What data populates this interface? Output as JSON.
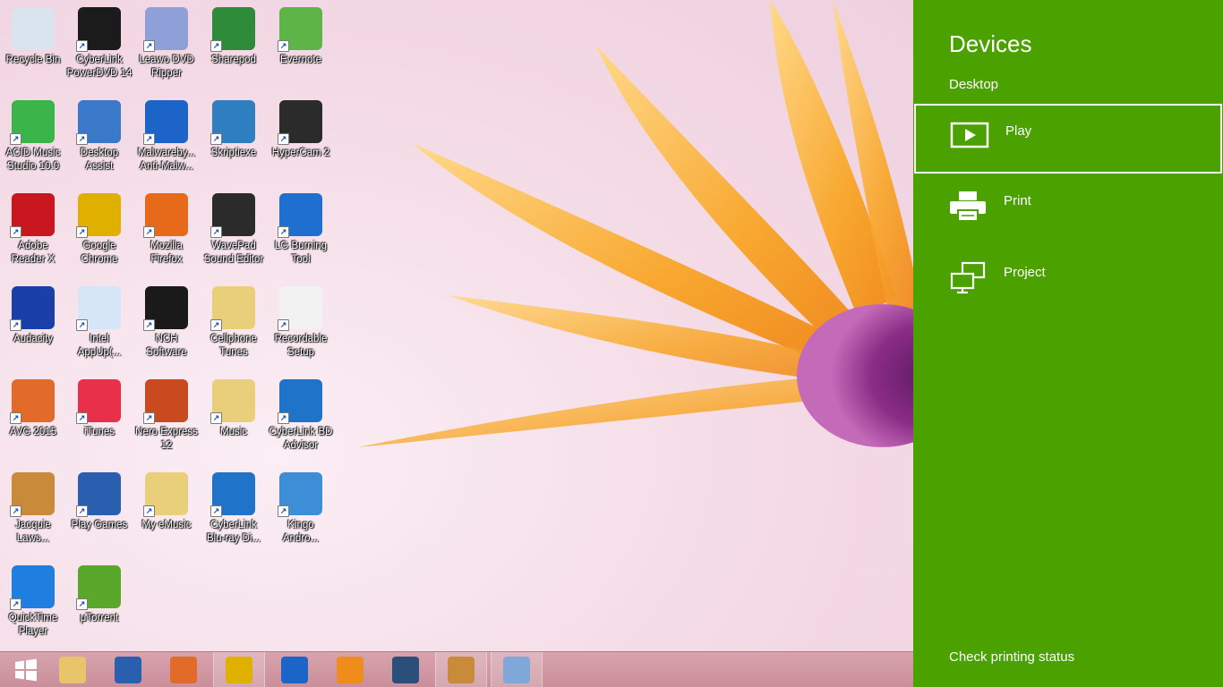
{
  "desktop": {
    "icons": [
      {
        "label": "Recycle Bin",
        "icon": "recycle-bin-icon",
        "color": "#d9e4ee"
      },
      {
        "label": "CyberLink\nPowerDVD 14",
        "icon": "powerdvd-icon",
        "color": "#1b1b1b"
      },
      {
        "label": "Leawo DVD\nRipper",
        "icon": "dvd-ripper-icon",
        "color": "#8fa0d8"
      },
      {
        "label": "Sharepod",
        "icon": "sharepod-icon",
        "color": "#2e8b3a"
      },
      {
        "label": "Evernote",
        "icon": "evernote-icon",
        "color": "#5db548"
      },
      {
        "label": "ACID Music\nStudio 10.0",
        "icon": "acid-music-icon",
        "color": "#3bb54a"
      },
      {
        "label": "Desktop\nAssist",
        "icon": "desktop-assist-icon",
        "color": "#3a78c9"
      },
      {
        "label": "Malwareby...\nAnti-Malw...",
        "icon": "malwarebytes-icon",
        "color": "#1d64c8"
      },
      {
        "label": "Skriptiexe",
        "icon": "skriptiexe-icon",
        "color": "#2f7fc0"
      },
      {
        "label": "HyperCam 2",
        "icon": "hypercam-icon",
        "color": "#2b2b2b"
      },
      {
        "label": "Adobe\nReader X",
        "icon": "adobe-reader-icon",
        "color": "#c8171e"
      },
      {
        "label": "Google\nChrome",
        "icon": "chrome-icon",
        "color": "#e0b000"
      },
      {
        "label": "Mozilla\nFirefox",
        "icon": "firefox-icon",
        "color": "#e66a1a"
      },
      {
        "label": "WavePad\nSound Editor",
        "icon": "wavepad-icon",
        "color": "#2b2b2b"
      },
      {
        "label": "LG Burning\nTool",
        "icon": "lg-burning-icon",
        "color": "#1e6fd0"
      },
      {
        "label": "Audacity",
        "icon": "audacity-icon",
        "color": "#1b3fa8"
      },
      {
        "label": "Intel\nAppUp(...",
        "icon": "intel-appup-icon",
        "color": "#d6e6f6"
      },
      {
        "label": "NCH\nSoftware",
        "icon": "nch-software-icon",
        "color": "#1a1a1a"
      },
      {
        "label": "Cellphone\nTunes",
        "icon": "folder-icon",
        "color": "#e9cf79"
      },
      {
        "label": "Recordable\nSetup",
        "icon": "recordable-setup-icon",
        "color": "#f2f2f2"
      },
      {
        "label": "AVG 2015",
        "icon": "avg-icon",
        "color": "#e26b2a"
      },
      {
        "label": "iTunes",
        "icon": "itunes-icon",
        "color": "#e8304a"
      },
      {
        "label": "Nero Express\n12",
        "icon": "nero-icon",
        "color": "#c94a1e"
      },
      {
        "label": "Music",
        "icon": "folder-icon",
        "color": "#e9cf79"
      },
      {
        "label": "CyberLink BD\nAdvisor",
        "icon": "bd-advisor-icon",
        "color": "#1f74c9"
      },
      {
        "label": "Jacquie\nLaws...",
        "icon": "carousel-icon",
        "color": "#c98b3a"
      },
      {
        "label": "Play Games",
        "icon": "play-games-icon",
        "color": "#2a5fb0"
      },
      {
        "label": "My eMusic",
        "icon": "folder-icon",
        "color": "#e9cf79"
      },
      {
        "label": "CyberLink\nBlu-ray Di...",
        "icon": "bluray-disc-icon",
        "color": "#1f74c9"
      },
      {
        "label": "Kingo\nAndro...",
        "icon": "kingo-icon",
        "color": "#3c8fd6"
      },
      {
        "label": "QuickTime\nPlayer",
        "icon": "quicktime-icon",
        "color": "#1f7fe0"
      },
      {
        "label": "μTorrent",
        "icon": "utorrent-icon",
        "color": "#5aa82a"
      }
    ]
  },
  "taskbar": {
    "items": [
      {
        "name": "start-button",
        "icon": "windows-logo-icon",
        "color": "#ffffff",
        "active": false
      },
      {
        "name": "file-explorer-button",
        "icon": "file-explorer-icon",
        "color": "#e8c46a",
        "active": false
      },
      {
        "name": "play-games-taskbar-button",
        "icon": "play-games-icon",
        "color": "#2a5fb0",
        "active": false
      },
      {
        "name": "avg-taskbar-button",
        "icon": "avg-icon",
        "color": "#e26b2a",
        "active": false
      },
      {
        "name": "chrome-taskbar-button",
        "icon": "chrome-icon",
        "color": "#e0b000",
        "active": true
      },
      {
        "name": "malwarebytes-taskbar-button",
        "icon": "malwarebytes-icon",
        "color": "#1d64c8",
        "active": false
      },
      {
        "name": "media-player-taskbar-button",
        "icon": "media-player-icon",
        "color": "#f08c1c",
        "active": false
      },
      {
        "name": "film-taskbar-button",
        "icon": "film-reel-icon",
        "color": "#2b4f7a",
        "active": false
      },
      {
        "name": "carousel-taskbar-button",
        "icon": "carousel-icon",
        "color": "#c98b3a",
        "active": true
      },
      {
        "name": "paint-taskbar-button",
        "icon": "paint-palette-icon",
        "color": "#7fa8d8",
        "active": true
      }
    ]
  },
  "charm": {
    "title": "Devices",
    "subtitle": "Desktop",
    "items": [
      {
        "label": "Play",
        "icon": "play-icon"
      },
      {
        "label": "Print",
        "icon": "printer-icon"
      },
      {
        "label": "Project",
        "icon": "project-icon"
      }
    ],
    "footer": "Check printing status",
    "accent": "#4aa100"
  }
}
